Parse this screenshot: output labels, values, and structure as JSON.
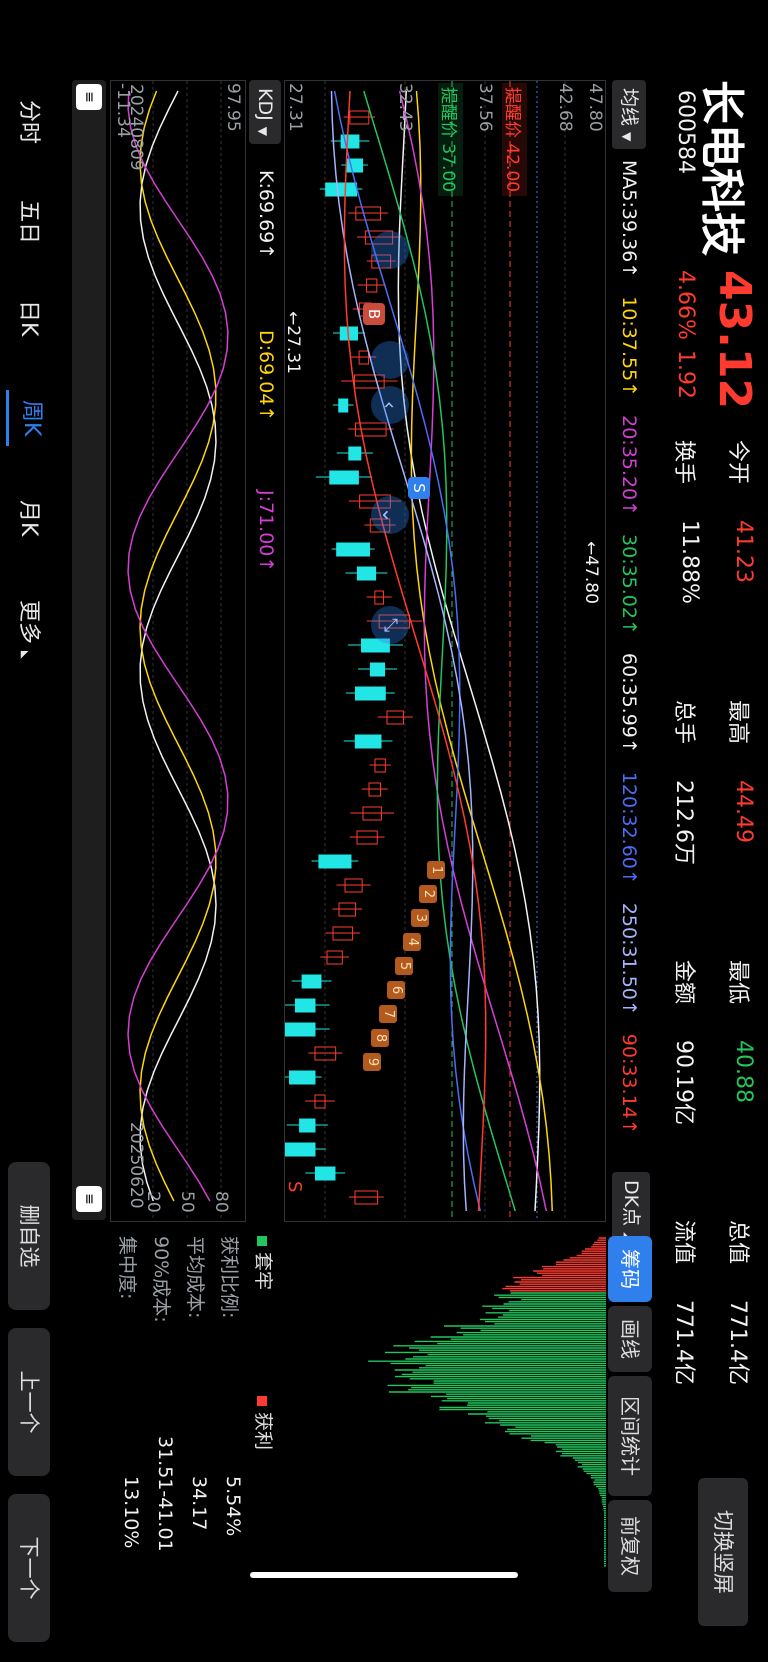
{
  "stock": {
    "name": "长电科技",
    "code": "600584",
    "price": "43.12",
    "change_pct": "4.66%",
    "change_amt": "1.92"
  },
  "stats": {
    "open_label": "今开",
    "open": "41.23",
    "high_label": "最高",
    "high": "44.49",
    "low_label": "最低",
    "low": "40.88",
    "total_label": "总值",
    "total": "771.4亿",
    "turnover_label": "换手",
    "turnover": "11.88%",
    "volume_label": "总手",
    "volume": "212.6万",
    "amount_label": "金额",
    "amount": "90.19亿",
    "float_label": "流值",
    "float": "771.4亿"
  },
  "switch_screen": "切换竖屏",
  "ma_bar": {
    "selector": "均线",
    "items": [
      {
        "text": "MA5:39.36↑",
        "color": "#f2f2f2"
      },
      {
        "text": "10:37.55↑",
        "color": "#ffd60a"
      },
      {
        "text": "20:35.20↑",
        "color": "#d63fd6"
      },
      {
        "text": "30:35.02↑",
        "color": "#22c55e"
      },
      {
        "text": "60:35.99↑",
        "color": "#f2f2f2"
      },
      {
        "text": "120:32.60↑",
        "color": "#4c6ef5"
      },
      {
        "text": "250:31.50↑",
        "color": "#a5b4fc"
      },
      {
        "text": "90:33.14↑",
        "color": "#ff3b30"
      }
    ],
    "dk": "DK点"
  },
  "side_tabs": [
    "筹码",
    "画线",
    "区间统计",
    "前复权"
  ],
  "main_chart": {
    "y_labels": [
      "47.80",
      "42.68",
      "37.56",
      "32.43",
      "27.31"
    ],
    "alert_red": "提醒价 42.00",
    "alert_green": "提醒价 37.00",
    "high_marker": "←47.80",
    "low_marker": "←27.31",
    "s_label": "S",
    "b_marker": "B",
    "s_marker": "S",
    "seq_numbers": [
      "1",
      "2",
      "3",
      "4",
      "5",
      "6",
      "7",
      "8",
      "9"
    ]
  },
  "kdj": {
    "selector": "KDJ",
    "k": "K:69.69↑",
    "d": "D:69.04↑",
    "j": "J:71.00↑",
    "y_top": "97.95",
    "y_bottom": "-11.34",
    "y_marks": [
      "80",
      "50",
      "20"
    ],
    "date_start": "20240809",
    "date_end": "20250620"
  },
  "chips": {
    "legend_trapped": "套牢",
    "legend_profit": "获利",
    "profit_ratio_label": "获利比例:",
    "profit_ratio": "5.54%",
    "avg_cost_label": "平均成本:",
    "avg_cost": "34.17",
    "cost90_label": "90%成本:",
    "cost90": "31.51-41.01",
    "concentration_label": "集中度:",
    "concentration": "13.10%"
  },
  "tabs": [
    "分时",
    "五日",
    "日K",
    "周K",
    "月K",
    "更多"
  ],
  "active_tab": "周K",
  "bottom_buttons": [
    "删自选",
    "上一个",
    "下一个"
  ],
  "colors": {
    "up": "#ff3b30",
    "down": "#22e5e5",
    "accent": "#2f80ed"
  }
}
